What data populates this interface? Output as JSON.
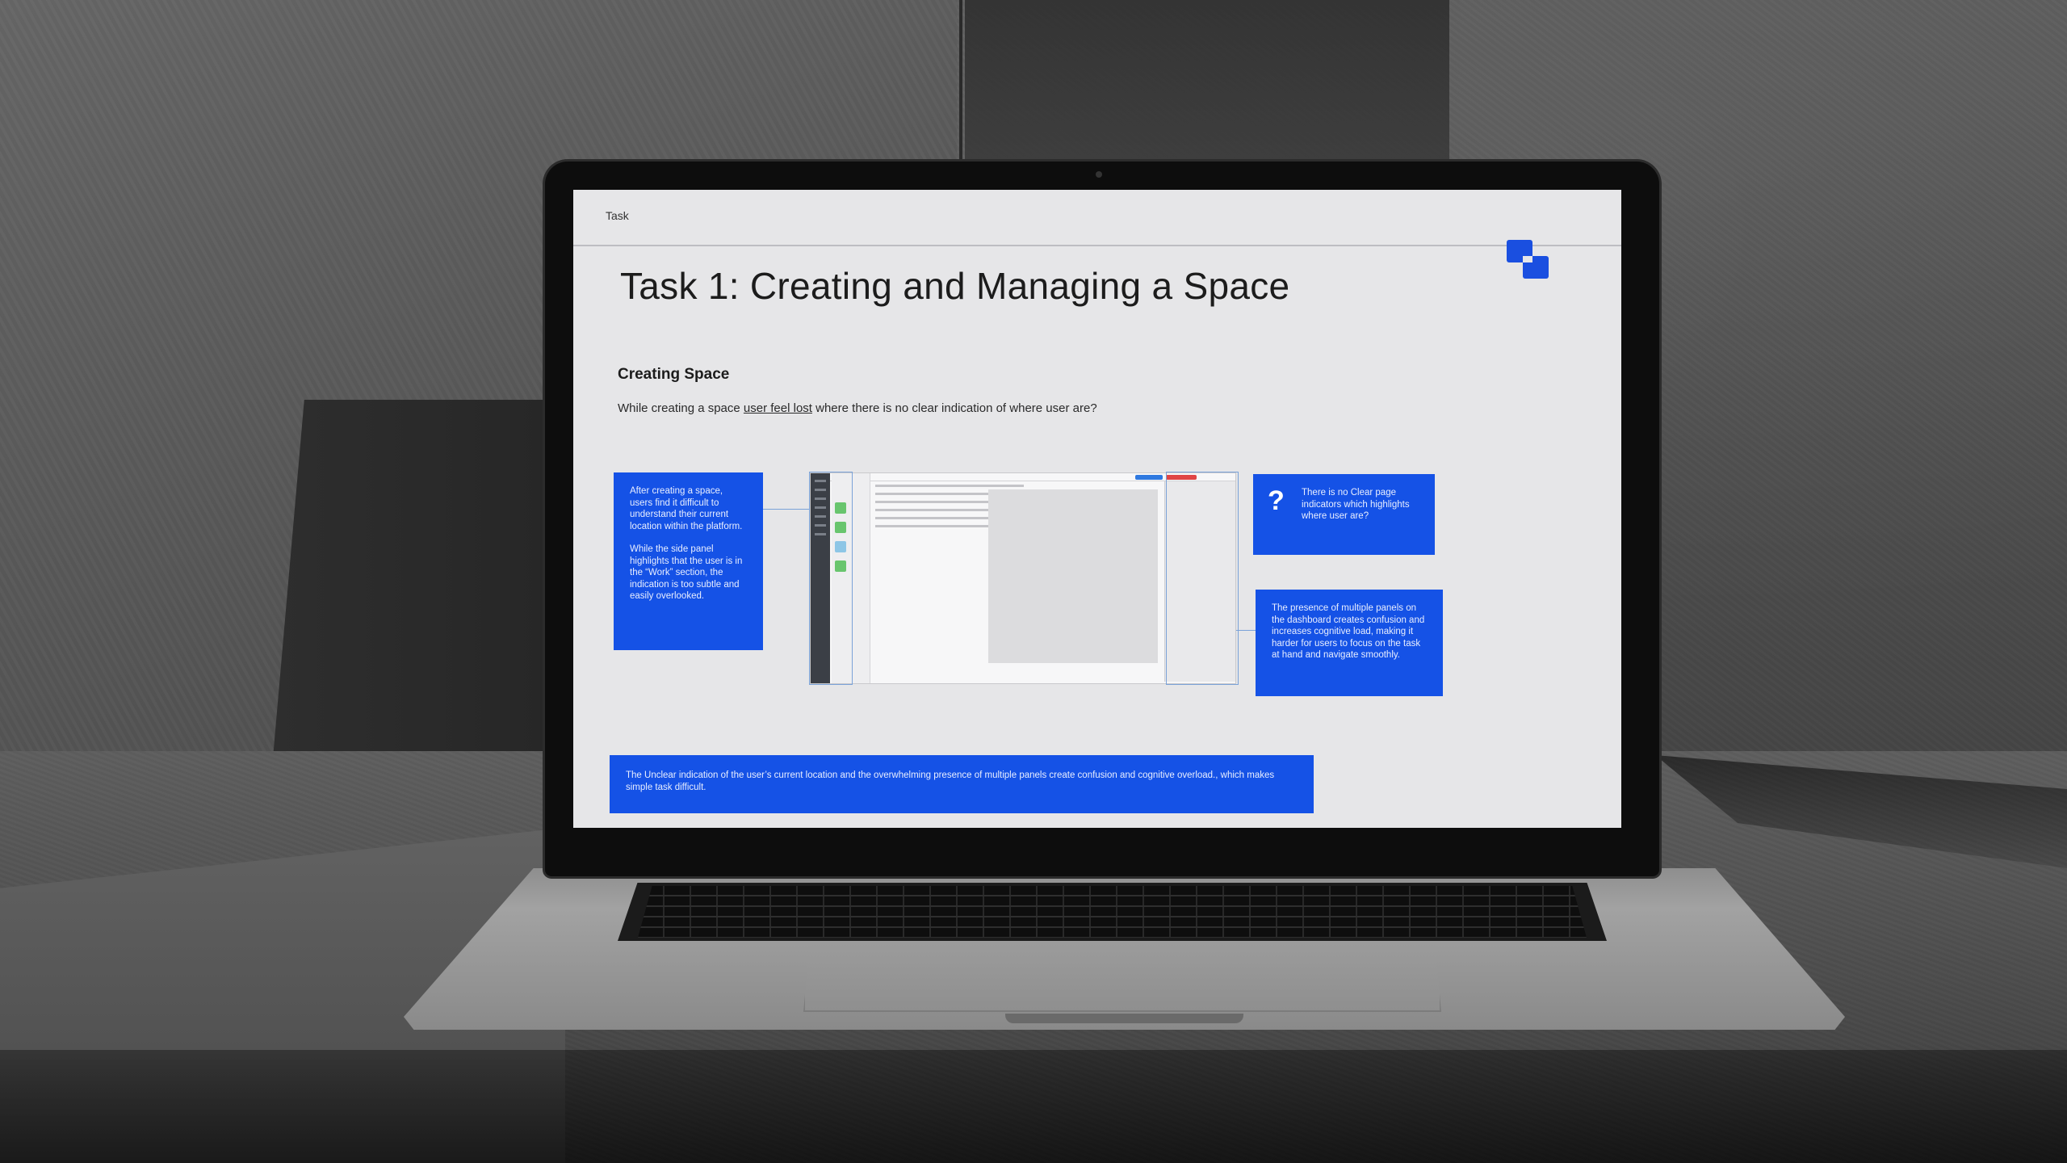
{
  "scene": {
    "description_tag": "",
    "brand": {
      "accent": "#1552e6",
      "logo_color": "#1a4fe0"
    }
  },
  "slide": {
    "topbar_label": "Task",
    "title": "Task 1: Creating and Managing a Space",
    "section_title": "Creating Space",
    "intro": {
      "before": "While creating a space ",
      "underlined": "user feel lost",
      "after": " where there is no clear indication of where user are?"
    },
    "note_left": {
      "p1": "After creating a space, users find it difficult to understand their current location within the platform.",
      "p2": "While the side panel highlights that the user is in the “Work” section, the indication is too subtle and easily overlooked."
    },
    "note_question": {
      "symbol": "?",
      "text": "There is no Clear page indicators which highlights where user are?"
    },
    "note_right": {
      "text": "The presence of multiple panels on the dashboard creates confusion and increases cognitive load, making it harder for users to focus on the task at hand and navigate smoothly."
    },
    "note_bottom": {
      "text": "The Unclear indication of the user’s current location and the overwhelming presence of multiple panels create confusion and cognitive overload., which makes simple task difficult."
    }
  }
}
